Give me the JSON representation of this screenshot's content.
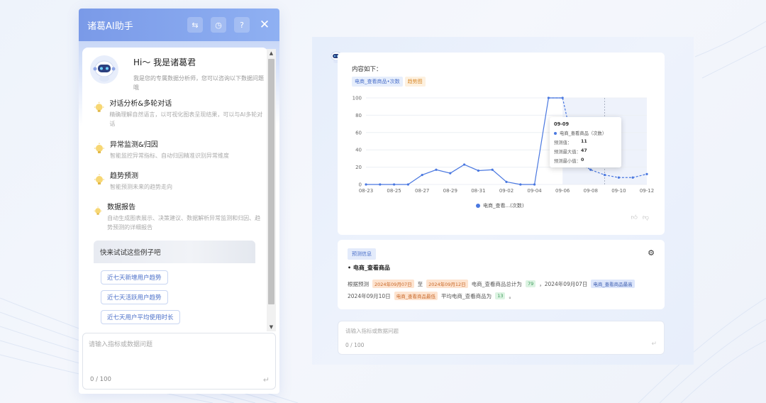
{
  "left_panel": {
    "title": "诸葛AI助手",
    "header_icons": [
      "swap-icon",
      "history-icon",
      "help-icon",
      "close-icon"
    ],
    "greeting": {
      "title": "Hi～ 我是诸葛君",
      "desc": "我是您的专属数据分析师，您可以咨询以下数据问题哦"
    },
    "features": [
      {
        "title": "对话分析&多轮对话",
        "desc": "精确理解自然语言，以可视化图表呈现结果，可以与AI多轮对话"
      },
      {
        "title": "异常监测&归因",
        "desc": "智能监控异常指标、自动归因精准识别异常维度"
      },
      {
        "title": "趋势预测",
        "desc": "智能预测未来的趋势走向"
      },
      {
        "title": "数据报告",
        "desc": "自动生成图表展示、决策建议、数据解析异常监测和归因、趋势预测的详细报告"
      }
    ],
    "examples": {
      "head": "快来试试这些例子吧",
      "chips": [
        "近七天新增用户趋势",
        "近七天活跃用户趋势",
        "近七天用户平均使用时长"
      ]
    },
    "input": {
      "placeholder": "请输入指标或数据问题",
      "count": "0 / 100"
    }
  },
  "right_panel": {
    "chart_card": {
      "title": "内容如下：",
      "tags": [
        "电商_查看商品•次数",
        "趋势图"
      ],
      "legend": "电商_查看...(次数)",
      "actions": [
        "thumb-up-icon",
        "thumb-down-icon"
      ],
      "tooltip": {
        "date": "09-09",
        "series": "电商_查看商品（次数）",
        "rows": [
          {
            "label": "预测值：",
            "value": "11"
          },
          {
            "label": "预测最大值：",
            "value": "47"
          },
          {
            "label": "预测最小值：",
            "value": "0"
          }
        ]
      }
    },
    "info_card": {
      "tag": "预测信息",
      "head": "电商_查看商品",
      "line1": {
        "a": "根据预测",
        "d1": "2024年09月07日",
        "b": "至",
        "d2": "2024年09月12日",
        "c": "电商_查看商品总计为",
        "v1": "79",
        "d": "，2024年09月07日",
        "e": "电商_查看商品最高"
      },
      "line2": {
        "a": "2024年09月10日",
        "e": "电商_查看商品最低",
        "b": "平均电商_查看商品为",
        "v2": "13",
        "c": "。"
      }
    },
    "input": {
      "placeholder": "请输入指标或数据问题",
      "count": "0 / 100"
    }
  },
  "chart_data": {
    "type": "line",
    "x": [
      "08-23",
      "08-24",
      "08-25",
      "08-26",
      "08-27",
      "08-28",
      "08-29",
      "08-30",
      "08-31",
      "09-01",
      "09-02",
      "09-03",
      "09-04",
      "09-05",
      "09-06",
      "09-07",
      "09-08",
      "09-09",
      "09-10",
      "09-11",
      "09-12"
    ],
    "x_ticks": [
      "08-23",
      "08-25",
      "08-27",
      "08-29",
      "08-31",
      "09-02",
      "09-04",
      "09-06",
      "09-08",
      "09-10",
      "09-12"
    ],
    "y_ticks": [
      0,
      20,
      40,
      60,
      80,
      100
    ],
    "ylim": [
      0,
      100
    ],
    "series": [
      {
        "name": "电商_查看...(次数)",
        "values": [
          0,
          0,
          0,
          0,
          11,
          17,
          13,
          23,
          16,
          17,
          3,
          0,
          0,
          100,
          100,
          27,
          17,
          11,
          8,
          8,
          12
        ]
      }
    ],
    "forecast_start_index": 14,
    "highlight_index": 17,
    "color": "#4a78e0"
  }
}
